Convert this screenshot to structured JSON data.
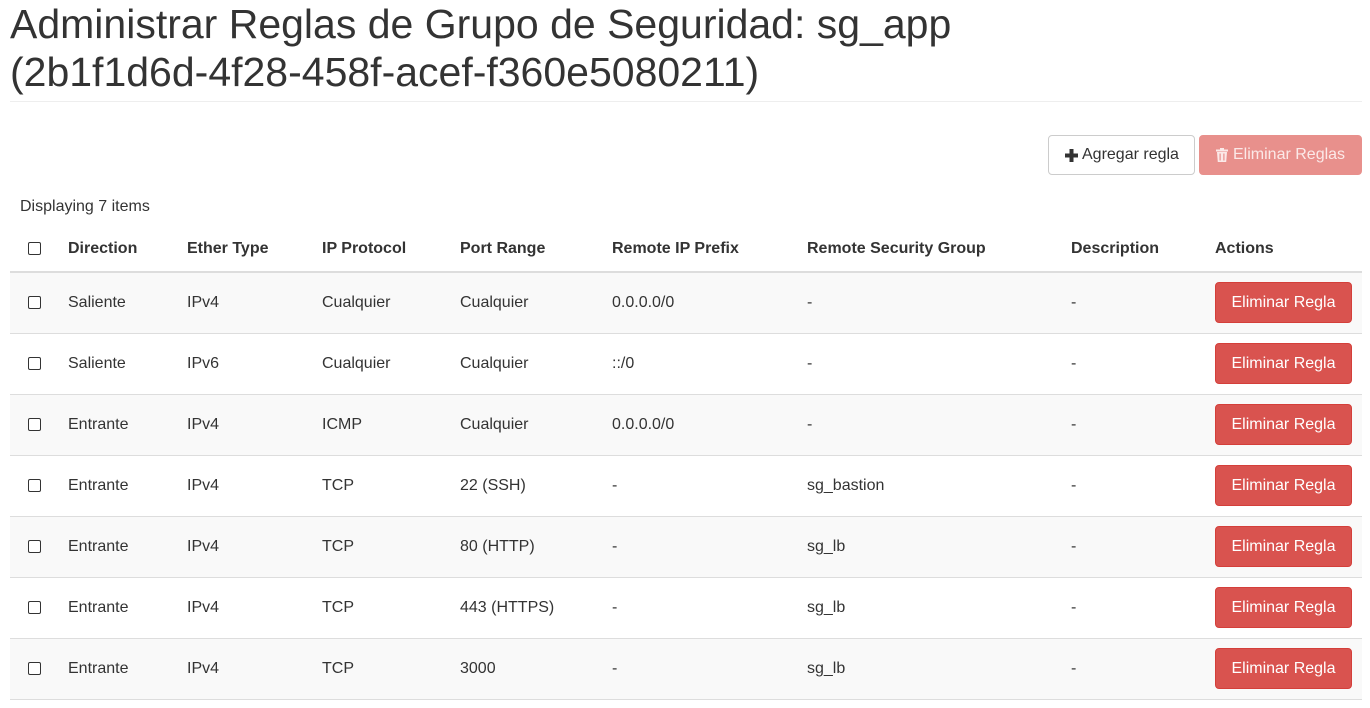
{
  "header": {
    "title_line1": "Administrar Reglas de Grupo de Seguridad: sg_app",
    "title_line2": "(2b1f1d6d-4f28-458f-acef-f360e5080211)"
  },
  "toolbar": {
    "add_label": "Agregar regla",
    "add_icon": "plus-icon",
    "delete_all_label": "Eliminar Reglas",
    "delete_all_icon": "trash-icon",
    "delete_all_disabled": true
  },
  "table": {
    "count_label": "Displaying 7 items",
    "columns": [
      "Direction",
      "Ether Type",
      "IP Protocol",
      "Port Range",
      "Remote IP Prefix",
      "Remote Security Group",
      "Description",
      "Actions"
    ],
    "rows": [
      {
        "direction": "Saliente",
        "ether_type": "IPv4",
        "ip_protocol": "Cualquier",
        "port_range": "Cualquier",
        "remote_ip_prefix": "0.0.0.0/0",
        "remote_security_group": "-",
        "description": "-",
        "action_label": "Eliminar Regla"
      },
      {
        "direction": "Saliente",
        "ether_type": "IPv6",
        "ip_protocol": "Cualquier",
        "port_range": "Cualquier",
        "remote_ip_prefix": "::/0",
        "remote_security_group": "-",
        "description": "-",
        "action_label": "Eliminar Regla"
      },
      {
        "direction": "Entrante",
        "ether_type": "IPv4",
        "ip_protocol": "ICMP",
        "port_range": "Cualquier",
        "remote_ip_prefix": "0.0.0.0/0",
        "remote_security_group": "-",
        "description": "-",
        "action_label": "Eliminar Regla"
      },
      {
        "direction": "Entrante",
        "ether_type": "IPv4",
        "ip_protocol": "TCP",
        "port_range": "22 (SSH)",
        "remote_ip_prefix": "-",
        "remote_security_group": "sg_bastion",
        "description": "-",
        "action_label": "Eliminar Regla"
      },
      {
        "direction": "Entrante",
        "ether_type": "IPv4",
        "ip_protocol": "TCP",
        "port_range": "80 (HTTP)",
        "remote_ip_prefix": "-",
        "remote_security_group": "sg_lb",
        "description": "-",
        "action_label": "Eliminar Regla"
      },
      {
        "direction": "Entrante",
        "ether_type": "IPv4",
        "ip_protocol": "TCP",
        "port_range": "443 (HTTPS)",
        "remote_ip_prefix": "-",
        "remote_security_group": "sg_lb",
        "description": "-",
        "action_label": "Eliminar Regla"
      },
      {
        "direction": "Entrante",
        "ether_type": "IPv4",
        "ip_protocol": "TCP",
        "port_range": "3000",
        "remote_ip_prefix": "-",
        "remote_security_group": "sg_lb",
        "description": "-",
        "action_label": "Eliminar Regla"
      }
    ]
  },
  "colors": {
    "danger": "#d9534f",
    "danger_disabled": "#e8908c",
    "stripe": "#f9f9f9",
    "border": "#dddddd"
  }
}
